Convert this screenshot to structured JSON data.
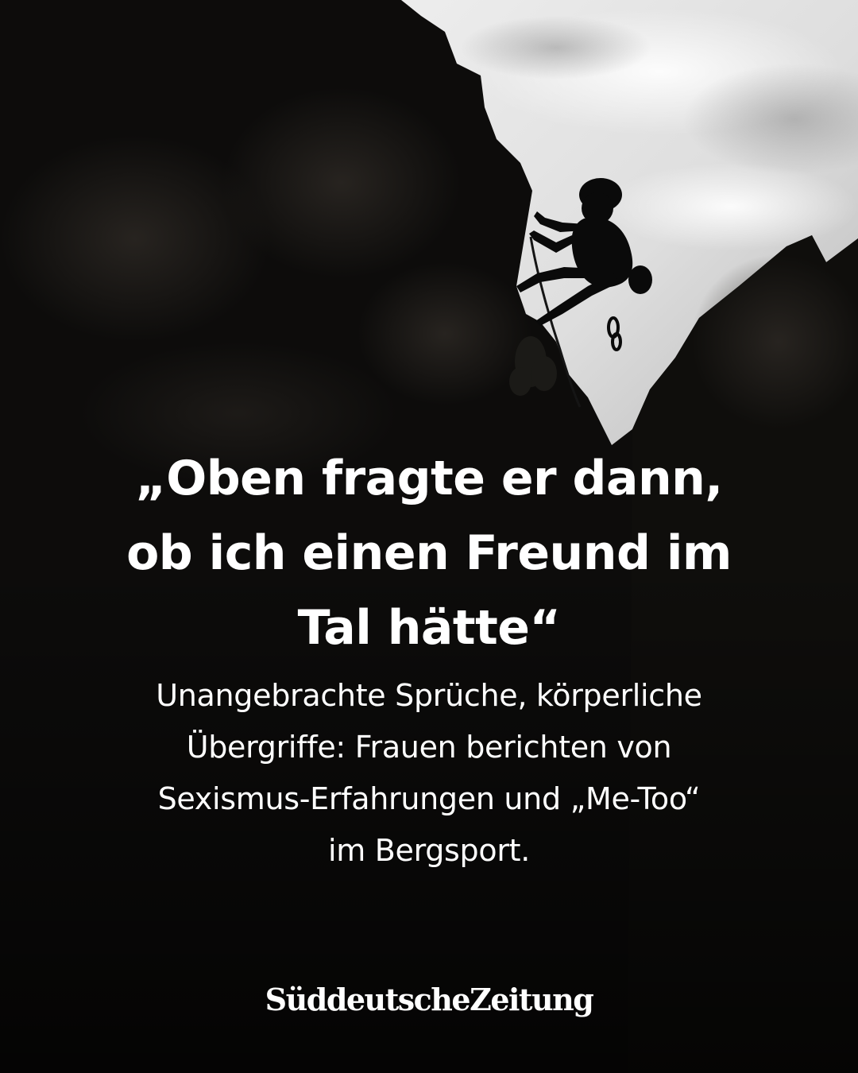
{
  "post": {
    "headline_line1": "„Oben fragte er dann,",
    "headline_line2": "ob ich einen Freund im",
    "headline_line3": "Tal hätte“",
    "subline_line1": "Unangebrachte Sprüche, körperliche",
    "subline_line2": "Übergriffe: Frauen berichten von",
    "subline_line3": "Sexismus-Erfahrungen und „Me-Too“",
    "subline_line4": "im Bergsport.",
    "logo_text": "SüddeutscheZeitung"
  },
  "photo": {
    "subject": "climber-silhouette"
  },
  "colors": {
    "text": "#ffffff",
    "rock": "#0c0c0c",
    "sky_light": "#f1f1f1",
    "sky_mid": "#c9c9c9"
  }
}
